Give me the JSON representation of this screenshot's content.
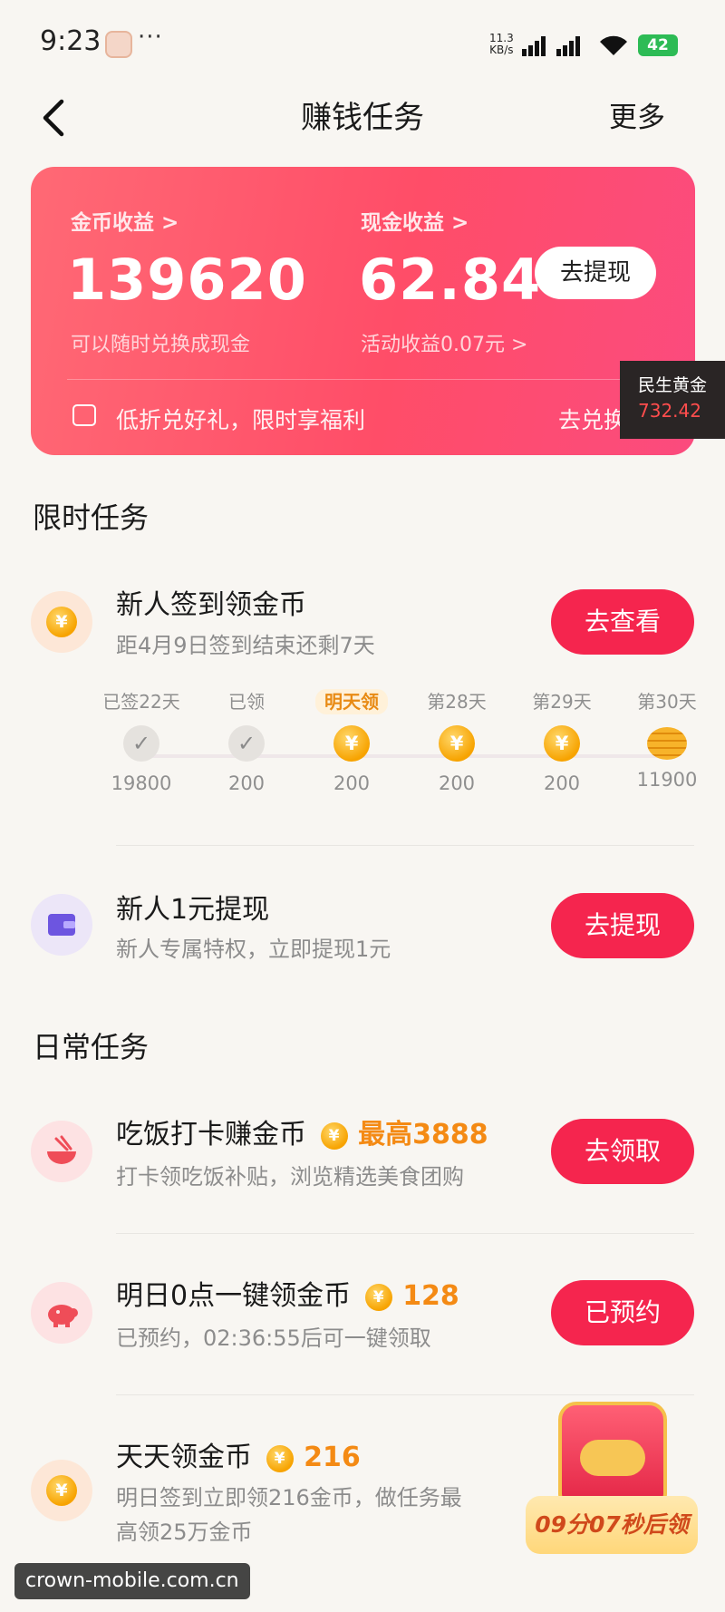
{
  "status_bar": {
    "time": "9:23",
    "more": "···",
    "speed_top": "11.3",
    "speed_bottom": "KB/s",
    "battery": "42"
  },
  "header": {
    "title": "赚钱任务",
    "more": "更多"
  },
  "earnings": {
    "coin_label": "金币收益 >",
    "coin_value": "139620",
    "coin_sub": "可以随时兑换成现金",
    "cash_label": "现金收益 >",
    "cash_value": "62.84",
    "cash_sub": "活动收益0.07元 >",
    "withdraw": "去提现",
    "promo": "低折兑好礼，限时享福利",
    "exchange": "去兑换"
  },
  "gold_widget": {
    "name": "民生黄金",
    "value": "732.42"
  },
  "limited": {
    "heading": "限时任务",
    "checkin": {
      "title": "新人签到领金币",
      "subtitle": "距4月9日签到结束还剩7天",
      "button": "去查看",
      "days": [
        {
          "label": "已签22天",
          "value": "19800"
        },
        {
          "label": "已领",
          "value": "200"
        },
        {
          "label": "明天领",
          "value": "200"
        },
        {
          "label": "第28天",
          "value": "200"
        },
        {
          "label": "第29天",
          "value": "200"
        },
        {
          "label": "第30天",
          "value": "11900"
        }
      ]
    },
    "newbie": {
      "title": "新人1元提现",
      "subtitle": "新人专属特权，立即提现1元",
      "button": "去提现"
    }
  },
  "daily": {
    "heading": "日常任务",
    "tasks": [
      {
        "title": "吃饭打卡赚金币",
        "reward": "最高3888",
        "subtitle": "打卡领吃饭补贴，浏览精选美食团购",
        "button": "去领取"
      },
      {
        "title": "明日0点一键领金币",
        "reward": "128",
        "subtitle": "已预约，02:36:55后可一键领取",
        "button": "已预约"
      },
      {
        "title": "天天领金币",
        "reward": "216",
        "subtitle_1": "明日签到立即领216金币，做任务最",
        "subtitle_2": "高领25万金币"
      }
    ]
  },
  "treasure": {
    "countdown": "09分07秒后领"
  },
  "watermark": "crown-mobile.com.cn",
  "colors": {
    "primary_red": "#f5254e",
    "card_gradient_start": "#ff6975",
    "card_gradient_end": "#fb4b7e",
    "reward_orange": "#f48a14"
  },
  "icons": [
    "back-icon",
    "coin-icon",
    "wallet-icon",
    "bowl-icon",
    "piggy-bank-icon",
    "gift-icon",
    "treasure-chest-icon"
  ]
}
